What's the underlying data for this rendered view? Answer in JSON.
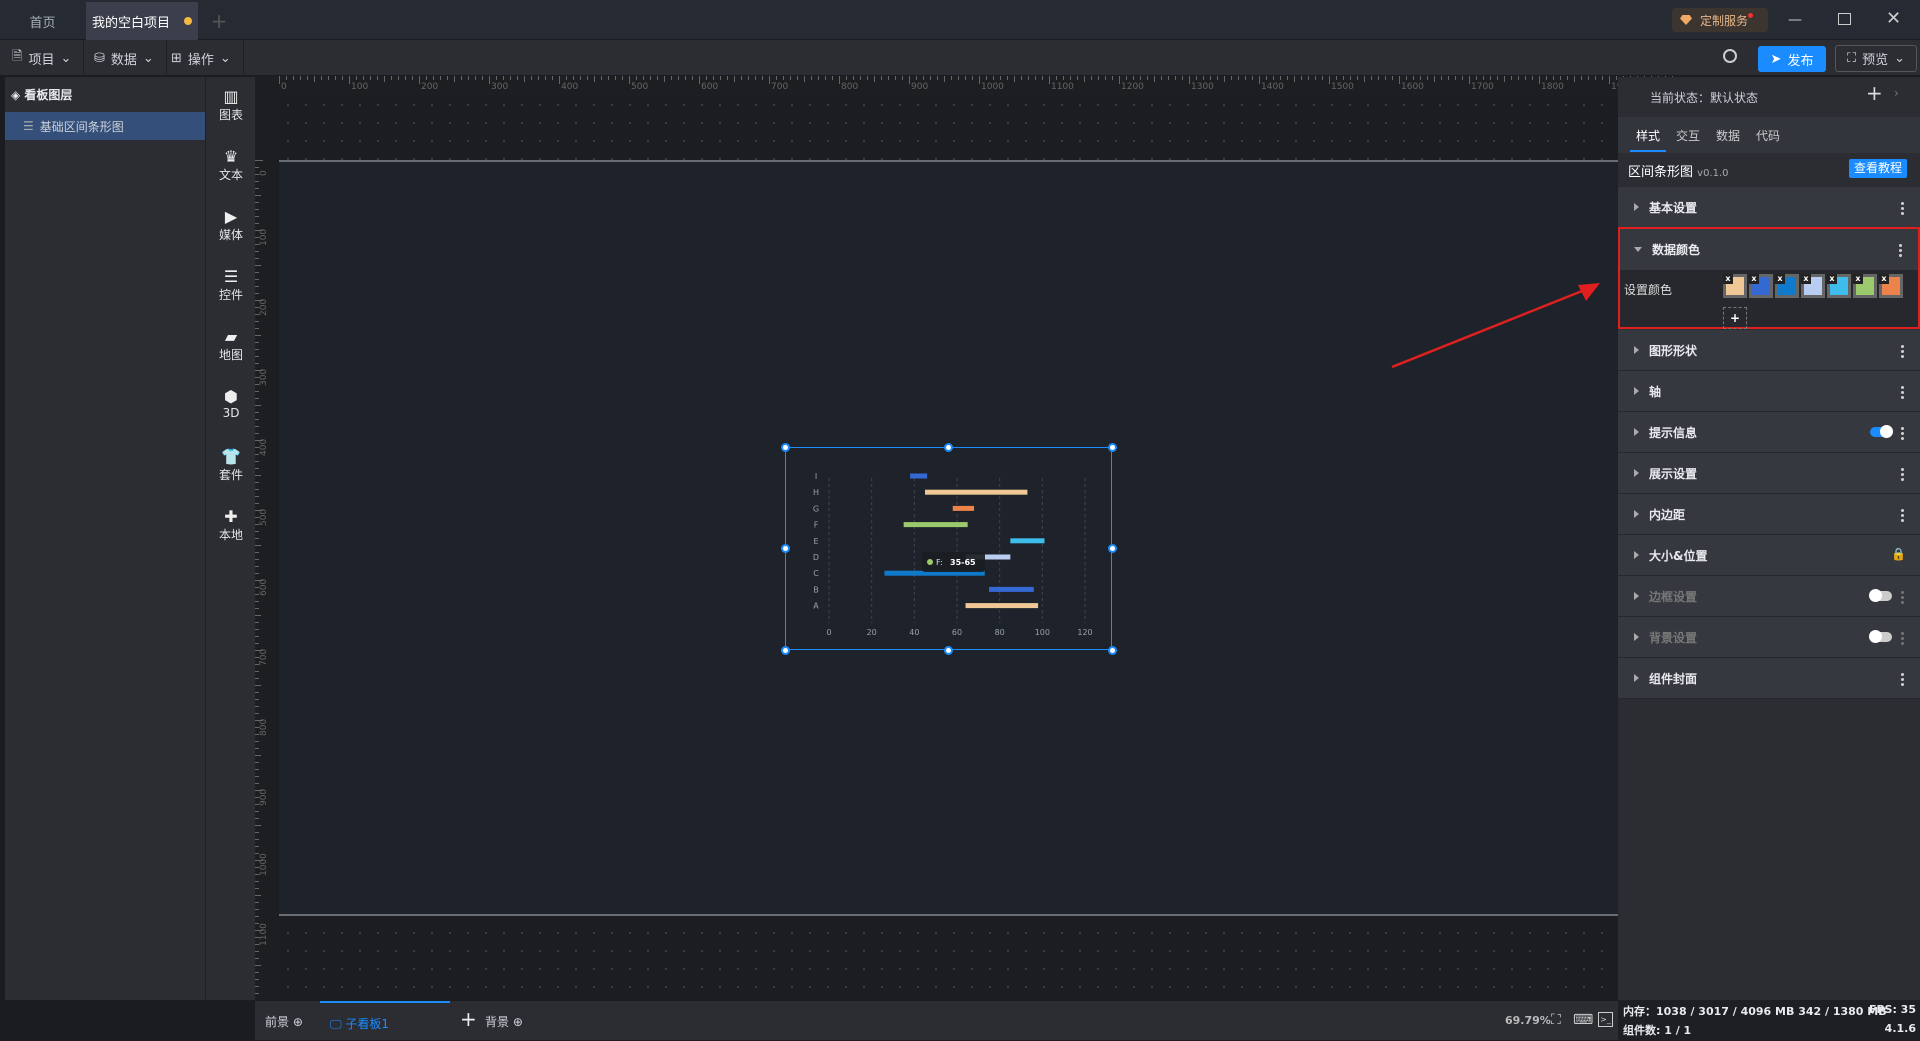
{
  "tabs": {
    "home": "首页",
    "project": "我的空白项目"
  },
  "window": {
    "custom_service": "定制服务"
  },
  "toolbar": {
    "project": "项目",
    "data": "数据",
    "operate": "操作",
    "publish": "发布",
    "preview": "预览"
  },
  "layers": {
    "title": "看板图层",
    "items": [
      "基础区间条形图"
    ]
  },
  "components": [
    "图表",
    "文本",
    "媒体",
    "控件",
    "地图",
    "3D",
    "套件",
    "本地"
  ],
  "ruler": {
    "x": [
      "0",
      "100",
      "200",
      "300",
      "400",
      "500",
      "600",
      "700",
      "800",
      "900",
      "1000",
      "1100",
      "1200",
      "1300",
      "1400",
      "1500",
      "1600",
      "1700",
      "1800",
      "1900"
    ],
    "y": [
      "0",
      "100",
      "200",
      "300",
      "400",
      "500",
      "600",
      "700",
      "800",
      "900",
      "1000",
      "1100"
    ]
  },
  "right": {
    "state_label": "当前状态：",
    "state_value": "默认状态",
    "tabs": [
      "样式",
      "交互",
      "数据",
      "代码"
    ],
    "component_name": "区间条形图",
    "version": "v0.1.0",
    "tutorial": "查看教程",
    "basic": "基本设置",
    "data_color": "数据颜色",
    "set_color": "设置颜色",
    "colors": [
      "#f0c895",
      "#3469d4",
      "#0f7acc",
      "#b8cdf0",
      "#3ebdea",
      "#9cc96b",
      "#ec834a"
    ],
    "sections": [
      {
        "label": "图形形状",
        "ctl": "menu"
      },
      {
        "label": "轴",
        "ctl": "menu"
      },
      {
        "label": "提示信息",
        "ctl": "toggle-on"
      },
      {
        "label": "展示设置",
        "ctl": "menu"
      },
      {
        "label": "内边距",
        "ctl": "menu"
      },
      {
        "label": "大小&位置",
        "ctl": "lock"
      },
      {
        "label": "边框设置",
        "ctl": "toggle-off"
      },
      {
        "label": "背景设置",
        "ctl": "toggle-off"
      },
      {
        "label": "组件封面",
        "ctl": "menu"
      }
    ]
  },
  "bottom": {
    "foreground": "前景",
    "sub_board": "子看板1",
    "background": "背景",
    "zoom": "69.79%"
  },
  "status": {
    "memory": "内存：1038 / 3017 / 4096 MB  342 / 1380 MB",
    "fps": "FPS:  35",
    "count": "组件数: 1 / 1",
    "version": "4.1.6"
  },
  "chart_data": {
    "type": "bar",
    "orientation": "horizontal-range",
    "categories": [
      "A",
      "B",
      "C",
      "D",
      "E",
      "F",
      "G",
      "H",
      "I"
    ],
    "ranges": [
      [
        64,
        98
      ],
      [
        75,
        96
      ],
      [
        26,
        73
      ],
      [
        64,
        85
      ],
      [
        85,
        101
      ],
      [
        35,
        65
      ],
      [
        58,
        68
      ],
      [
        45,
        93
      ],
      [
        38,
        46
      ]
    ],
    "xticks": [
      "0",
      "20",
      "40",
      "60",
      "80",
      "100",
      "120"
    ],
    "xlim": [
      0,
      120
    ],
    "grid": "vertical-dashed",
    "tooltip": {
      "category": "F",
      "label": "F:",
      "value": "35-65"
    }
  }
}
